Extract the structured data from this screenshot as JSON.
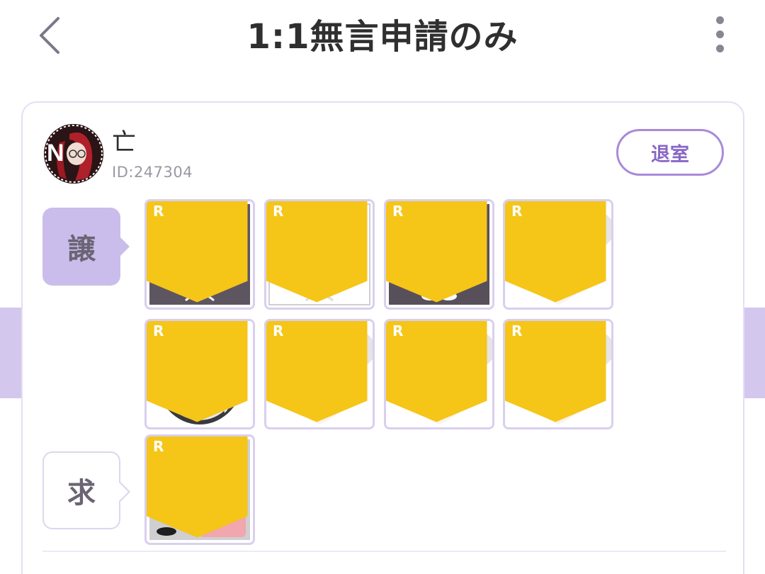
{
  "header": {
    "title": "1:1無言申請のみ"
  },
  "user": {
    "name": "亡",
    "id": "ID:247304",
    "leave_label": "退室"
  },
  "trade": {
    "give_label": "譲",
    "want_label": "求",
    "rarity": "R",
    "give_items": [
      {
        "icon": "head-stand-pink-flowers-icon"
      },
      {
        "icon": "head-stand-black-butterfly-icon"
      },
      {
        "icon": "white-cherry-dress-icon"
      },
      {
        "icon": "face-pink-eyes-icon"
      },
      {
        "icon": "white-hair-blue-ribbon-icon"
      },
      {
        "icon": "face-grey-eyes-icon"
      },
      {
        "icon": "face-sharp-eyes-icon"
      },
      {
        "icon": "face-soft-pink-eyes-icon"
      }
    ],
    "want_items": [
      {
        "icon": "yellow-suit-suitcases-icon"
      }
    ]
  },
  "colors": {
    "accent": "#8a66c7",
    "tag_give_bg": "#cabdeb",
    "badge": "#f5c518"
  }
}
